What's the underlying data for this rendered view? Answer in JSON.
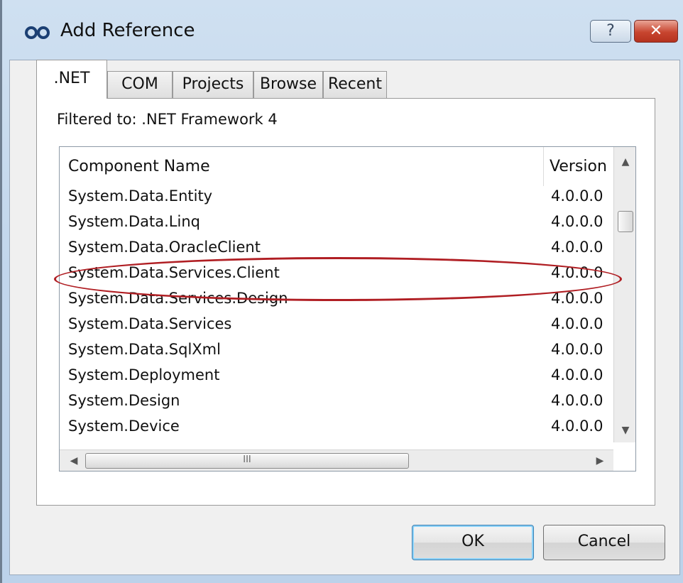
{
  "window": {
    "title": "Add Reference",
    "help_label": "?",
    "close_label": "✕"
  },
  "tabs": [
    {
      "label": ".NET",
      "active": true
    },
    {
      "label": "COM",
      "active": false
    },
    {
      "label": "Projects",
      "active": false
    },
    {
      "label": "Browse",
      "active": false
    },
    {
      "label": "Recent",
      "active": false
    }
  ],
  "filter_label": "Filtered to: .NET Framework 4",
  "list": {
    "columns": [
      "Component Name",
      "Version"
    ],
    "rows": [
      {
        "name": "System.Data.Entity",
        "version": "4.0.0.0"
      },
      {
        "name": "System.Data.Linq",
        "version": "4.0.0.0"
      },
      {
        "name": "System.Data.OracleClient",
        "version": "4.0.0.0"
      },
      {
        "name": "System.Data.Services.Client",
        "version": "4.0.0.0",
        "highlighted": true
      },
      {
        "name": "System.Data.Services.Design",
        "version": "4.0.0.0"
      },
      {
        "name": "System.Data.Services",
        "version": "4.0.0.0"
      },
      {
        "name": "System.Data.SqlXml",
        "version": "4.0.0.0"
      },
      {
        "name": "System.Deployment",
        "version": "4.0.0.0"
      },
      {
        "name": "System.Design",
        "version": "4.0.0.0"
      },
      {
        "name": "System.Device",
        "version": "4.0.0.0"
      }
    ],
    "hscroll_grip": "III"
  },
  "buttons": {
    "ok": "OK",
    "cancel": "Cancel"
  },
  "colors": {
    "highlight_ellipse": "#b01e23",
    "close_button": "#c8452f"
  },
  "icons": {
    "app": "add-reference-icon",
    "scroll_up": "scroll-up-arrow-icon",
    "scroll_down": "scroll-down-arrow-icon",
    "scroll_left": "scroll-left-arrow-icon",
    "scroll_right": "scroll-right-arrow-icon"
  }
}
